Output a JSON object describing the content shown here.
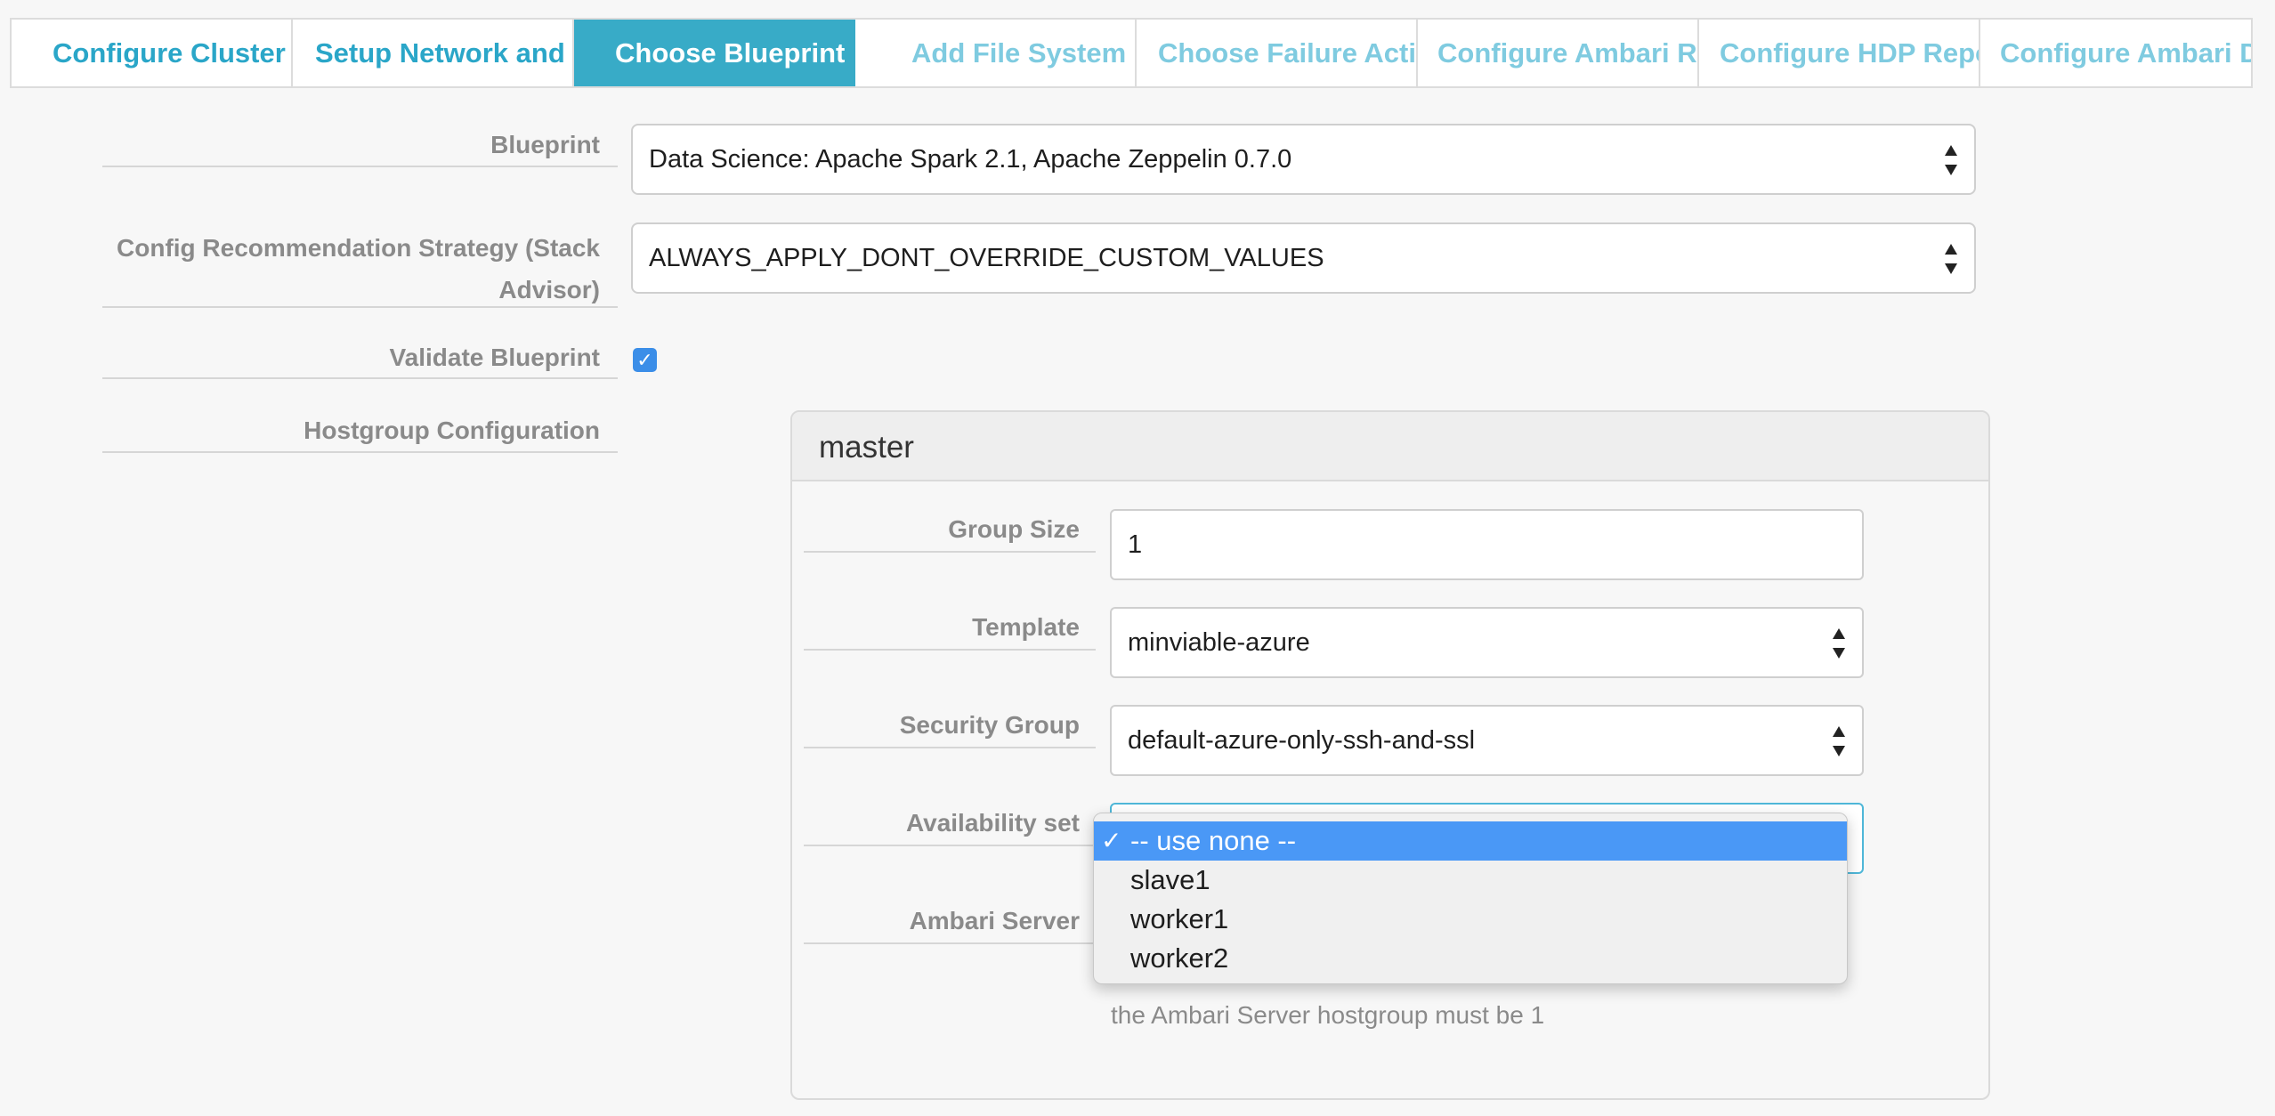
{
  "tabs": [
    {
      "label": "Configure Cluster",
      "state": "done"
    },
    {
      "label": "Setup Network and Security",
      "state": "done"
    },
    {
      "label": "Choose Blueprint",
      "state": "active"
    },
    {
      "label": "Add File System",
      "state": "pending"
    },
    {
      "label": "Choose Failure Action",
      "state": "pending"
    },
    {
      "label": "Configure Ambari Repos",
      "state": "pending"
    },
    {
      "label": "Configure HDP Repository",
      "state": "pending"
    },
    {
      "label": "Configure Ambari Database",
      "state": "pending"
    }
  ],
  "form": {
    "blueprint_label": "Blueprint",
    "blueprint_value": "Data Science: Apache Spark 2.1, Apache Zeppelin 0.7.0",
    "strategy_label_line1": "Config Recommendation Strategy (Stack",
    "strategy_label_line2": "Advisor)",
    "strategy_value": "ALWAYS_APPLY_DONT_OVERRIDE_CUSTOM_VALUES",
    "validate_label": "Validate Blueprint",
    "validate_checked": true,
    "hostgroup_label": "Hostgroup Configuration"
  },
  "hostgroup": {
    "title": "master",
    "group_size_label": "Group Size",
    "group_size_value": "1",
    "template_label": "Template",
    "template_value": "minviable-azure",
    "security_group_label": "Security Group",
    "security_group_value": "default-azure-only-ssh-and-ssl",
    "availability_label": "Availability set",
    "ambari_label": "Ambari Server",
    "help_text": "the Ambari Server hostgroup must be 1"
  },
  "availability_dropdown": {
    "options": [
      "-- use none --",
      "slave1",
      "worker1",
      "worker2"
    ],
    "selected_index": 0,
    "check_glyph": "✓"
  },
  "colors": {
    "accent": "#38abc7",
    "tab_done": "#2aa6c8",
    "tab_pending": "#7fcbe0",
    "dropdown_highlight": "#4a98f6",
    "label_gray": "#8a8a8a"
  }
}
